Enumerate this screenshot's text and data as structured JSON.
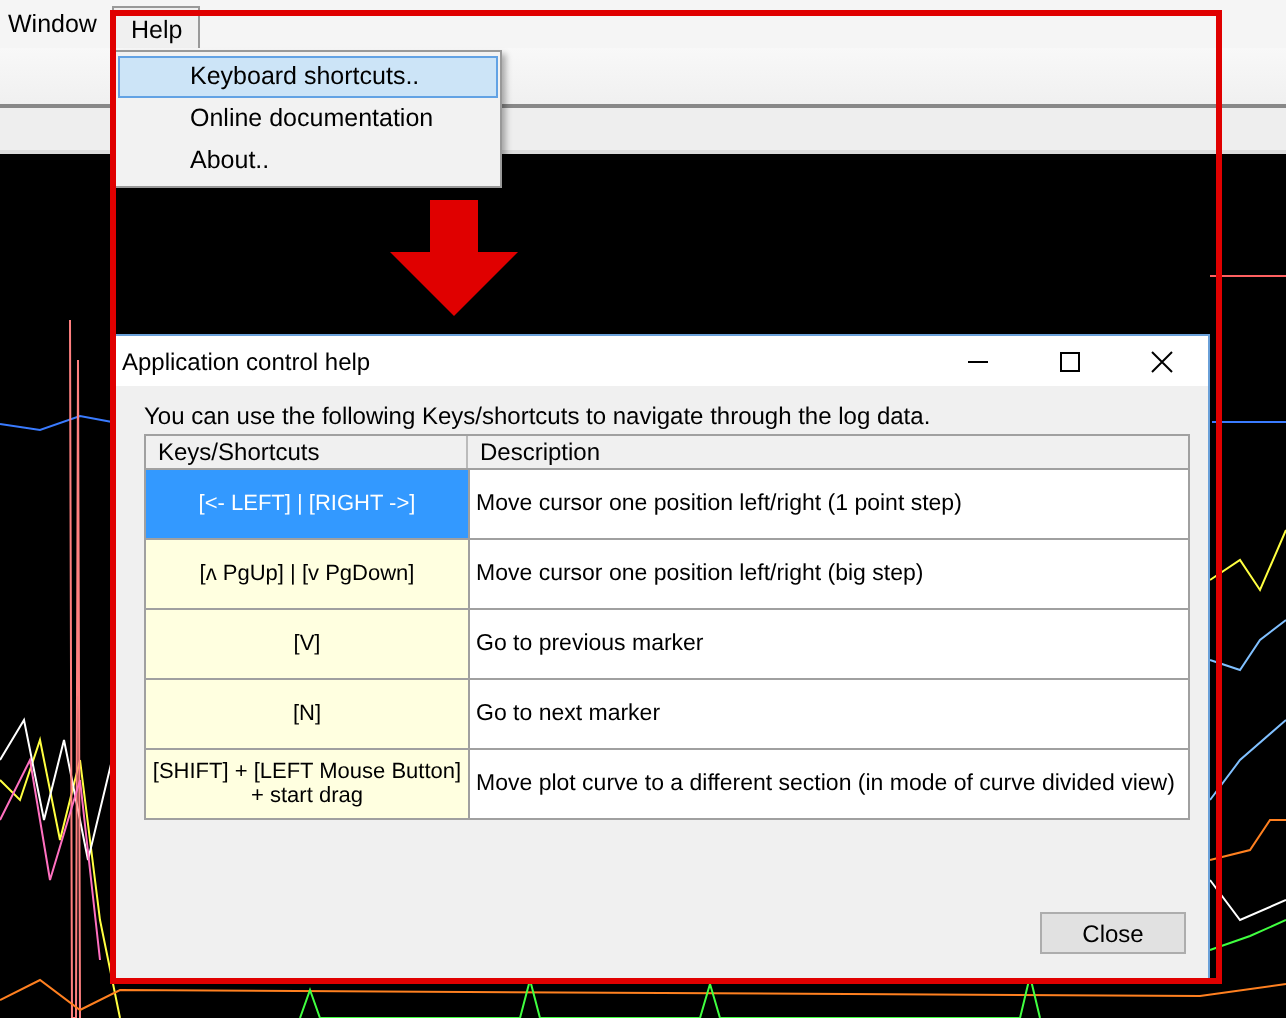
{
  "menu_bar": [
    {
      "label": "Window",
      "selected": false
    },
    {
      "label": "Help",
      "selected": true
    }
  ],
  "help_menu": {
    "items": [
      {
        "label": "Keyboard shortcuts..",
        "selected": true
      },
      {
        "label": "Online documentation",
        "selected": false
      },
      {
        "label": "About..",
        "selected": false
      }
    ]
  },
  "dialog": {
    "title": "Application control help",
    "intro": "You can use the following Keys/shortcuts to navigate through the log data.",
    "table": {
      "columns": [
        "Keys/Shortcuts",
        "Description"
      ],
      "rows": [
        {
          "keys": "[<- LEFT] | [RIGHT ->]",
          "description": "Move cursor one position left/right (1 point step)",
          "selected": true
        },
        {
          "keys": "[ʌ PgUp] | [v PgDown]",
          "description": "Move cursor one position left/right (big step)",
          "selected": false
        },
        {
          "keys": "[V]",
          "description": "Go to previous marker",
          "selected": false
        },
        {
          "keys": "[N]",
          "description": "Go to next marker",
          "selected": false
        },
        {
          "keys": "[SHIFT] + [LEFT Mouse Button]\n+ start drag",
          "description": "Move plot curve to a different section (in mode of curve divided view)",
          "selected": false
        }
      ]
    },
    "buttons": [
      "Close"
    ]
  }
}
